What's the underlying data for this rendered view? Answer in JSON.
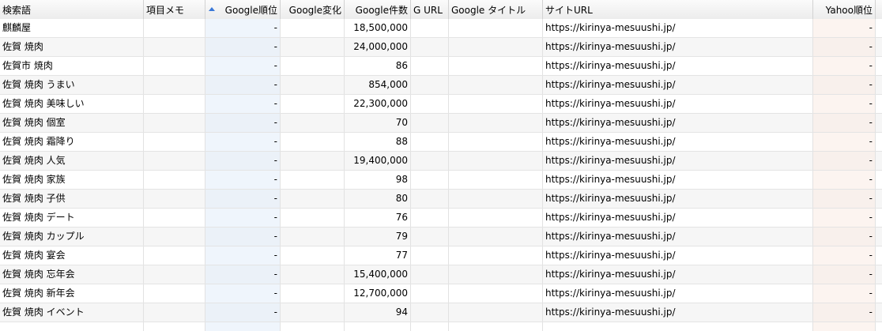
{
  "columns": {
    "keyword": "検索語",
    "memo": "項目メモ",
    "google_rank": "Google順位",
    "google_change": "Google変化",
    "google_count": "Google件数",
    "g_url": "G URL",
    "google_title": "Google タイトル",
    "site_url": "サイトURL",
    "yahoo_rank": "Yahoo順位"
  },
  "sort": {
    "column": "google_rank",
    "direction": "ascending",
    "icon": "sort-ascending-icon",
    "color": "#3a78d8"
  },
  "rows": [
    {
      "keyword": "麒麟屋",
      "memo": "",
      "google_rank": "-",
      "google_change": "",
      "google_count": "18,500,000",
      "g_url": "",
      "google_title": "",
      "site_url": "https://kirinya-mesuushi.jp/",
      "yahoo_rank": "-"
    },
    {
      "keyword": "佐賀 焼肉",
      "memo": "",
      "google_rank": "-",
      "google_change": "",
      "google_count": "24,000,000",
      "g_url": "",
      "google_title": "",
      "site_url": "https://kirinya-mesuushi.jp/",
      "yahoo_rank": "-"
    },
    {
      "keyword": "佐賀市 焼肉",
      "memo": "",
      "google_rank": "-",
      "google_change": "",
      "google_count": "86",
      "g_url": "",
      "google_title": "",
      "site_url": "https://kirinya-mesuushi.jp/",
      "yahoo_rank": "-"
    },
    {
      "keyword": "佐賀 焼肉 うまい",
      "memo": "",
      "google_rank": "-",
      "google_change": "",
      "google_count": "854,000",
      "g_url": "",
      "google_title": "",
      "site_url": "https://kirinya-mesuushi.jp/",
      "yahoo_rank": "-"
    },
    {
      "keyword": "佐賀 焼肉 美味しい",
      "memo": "",
      "google_rank": "-",
      "google_change": "",
      "google_count": "22,300,000",
      "g_url": "",
      "google_title": "",
      "site_url": "https://kirinya-mesuushi.jp/",
      "yahoo_rank": "-"
    },
    {
      "keyword": "佐賀 焼肉 個室",
      "memo": "",
      "google_rank": "-",
      "google_change": "",
      "google_count": "70",
      "g_url": "",
      "google_title": "",
      "site_url": "https://kirinya-mesuushi.jp/",
      "yahoo_rank": "-"
    },
    {
      "keyword": "佐賀 焼肉 霜降り",
      "memo": "",
      "google_rank": "-",
      "google_change": "",
      "google_count": "88",
      "g_url": "",
      "google_title": "",
      "site_url": "https://kirinya-mesuushi.jp/",
      "yahoo_rank": "-"
    },
    {
      "keyword": "佐賀 焼肉 人気",
      "memo": "",
      "google_rank": "-",
      "google_change": "",
      "google_count": "19,400,000",
      "g_url": "",
      "google_title": "",
      "site_url": "https://kirinya-mesuushi.jp/",
      "yahoo_rank": "-"
    },
    {
      "keyword": "佐賀 焼肉 家族",
      "memo": "",
      "google_rank": "-",
      "google_change": "",
      "google_count": "98",
      "g_url": "",
      "google_title": "",
      "site_url": "https://kirinya-mesuushi.jp/",
      "yahoo_rank": "-"
    },
    {
      "keyword": "佐賀 焼肉 子供",
      "memo": "",
      "google_rank": "-",
      "google_change": "",
      "google_count": "80",
      "g_url": "",
      "google_title": "",
      "site_url": "https://kirinya-mesuushi.jp/",
      "yahoo_rank": "-"
    },
    {
      "keyword": "佐賀 焼肉 デート",
      "memo": "",
      "google_rank": "-",
      "google_change": "",
      "google_count": "76",
      "g_url": "",
      "google_title": "",
      "site_url": "https://kirinya-mesuushi.jp/",
      "yahoo_rank": "-"
    },
    {
      "keyword": "佐賀 焼肉 カップル",
      "memo": "",
      "google_rank": "-",
      "google_change": "",
      "google_count": "79",
      "g_url": "",
      "google_title": "",
      "site_url": "https://kirinya-mesuushi.jp/",
      "yahoo_rank": "-"
    },
    {
      "keyword": "佐賀 焼肉 宴会",
      "memo": "",
      "google_rank": "-",
      "google_change": "",
      "google_count": "77",
      "g_url": "",
      "google_title": "",
      "site_url": "https://kirinya-mesuushi.jp/",
      "yahoo_rank": "-"
    },
    {
      "keyword": "佐賀 焼肉 忘年会",
      "memo": "",
      "google_rank": "-",
      "google_change": "",
      "google_count": "15,400,000",
      "g_url": "",
      "google_title": "",
      "site_url": "https://kirinya-mesuushi.jp/",
      "yahoo_rank": "-"
    },
    {
      "keyword": "佐賀 焼肉 新年会",
      "memo": "",
      "google_rank": "-",
      "google_change": "",
      "google_count": "12,700,000",
      "g_url": "",
      "google_title": "",
      "site_url": "https://kirinya-mesuushi.jp/",
      "yahoo_rank": "-"
    },
    {
      "keyword": "佐賀 焼肉 イベント",
      "memo": "",
      "google_rank": "-",
      "google_change": "",
      "google_count": "94",
      "g_url": "",
      "google_title": "",
      "site_url": "https://kirinya-mesuushi.jp/",
      "yahoo_rank": "-"
    }
  ]
}
